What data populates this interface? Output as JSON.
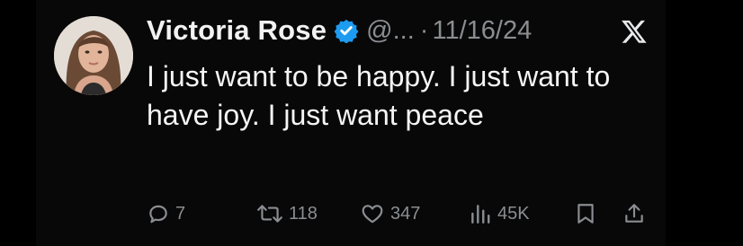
{
  "tweet": {
    "author_name": "Victoria Rose",
    "handle": "@...",
    "separator": "·",
    "date": "11/16/24",
    "text": "I just want to be happy. I just want to have joy. I just want peace",
    "colors": {
      "background": "#000000",
      "text": "#f5f5f5",
      "muted": "#8a8d91",
      "verified": "#1d9bf0"
    },
    "icons": {
      "verified": "verified-badge-icon",
      "platform": "x-logo-icon"
    }
  },
  "actions": {
    "replies": {
      "icon": "reply-icon",
      "count": "7"
    },
    "reposts": {
      "icon": "repost-icon",
      "count": "118"
    },
    "likes": {
      "icon": "heart-icon",
      "count": "347"
    },
    "views": {
      "icon": "views-icon",
      "count": "45K"
    },
    "bookmark": {
      "icon": "bookmark-icon"
    },
    "share": {
      "icon": "share-icon"
    }
  }
}
